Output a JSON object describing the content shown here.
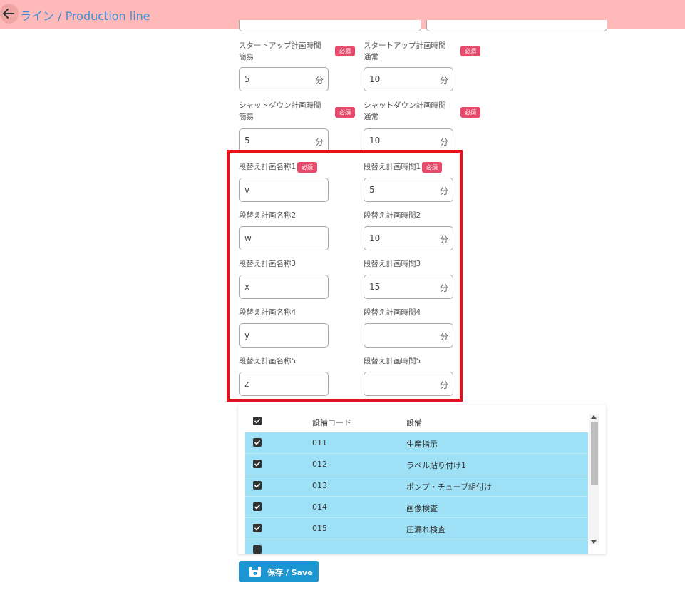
{
  "header": {
    "title": "ライン / Production line",
    "back_icon": "arrow-left-icon"
  },
  "required_label": "必須",
  "form": {
    "startup_simple_label": "スタートアップ計画時間簡易",
    "startup_simple_value": "5",
    "startup_normal_label": "スタートアップ計画時間通常",
    "startup_normal_value": "10",
    "shutdown_simple_label": "シャットダウン計画時間簡易",
    "shutdown_simple_value": "5",
    "shutdown_normal_label": "シャットダウン計画時間通常",
    "shutdown_normal_value": "10",
    "unit": "分",
    "changeover": [
      {
        "name_label": "段替え計画名称1",
        "name_value": "v",
        "time_label": "段替え計画時間1",
        "time_value": "5"
      },
      {
        "name_label": "段替え計画名称2",
        "name_value": "w",
        "time_label": "段替え計画時間2",
        "time_value": "10"
      },
      {
        "name_label": "段替え計画名称3",
        "name_value": "x",
        "time_label": "段替え計画時間3",
        "time_value": "15"
      },
      {
        "name_label": "段替え計画名称4",
        "name_value": "y",
        "time_label": "段替え計画時間4",
        "time_value": ""
      },
      {
        "name_label": "段替え計画名称5",
        "name_value": "z",
        "time_label": "段替え計画時間5",
        "time_value": ""
      }
    ]
  },
  "equipment_table": {
    "columns": [
      "設備コード",
      "設備"
    ],
    "rows": [
      {
        "code": "011",
        "name": "生産指示"
      },
      {
        "code": "012",
        "name": "ラベル貼り付け1"
      },
      {
        "code": "013",
        "name": "ポンプ・チューブ組付け"
      },
      {
        "code": "014",
        "name": "画像検査"
      },
      {
        "code": "015",
        "name": "圧漏れ検査"
      }
    ]
  },
  "save_button": {
    "label": "保存 / Save",
    "icon": "floppy-disk-icon"
  },
  "colors": {
    "header_bg": "#ffb9b9",
    "title": "#3d8fd4",
    "required_badge": "#e64b6c",
    "highlight_border": "#e8101a",
    "selected_row": "#9ee1f7",
    "save_button": "#1b96d2"
  }
}
